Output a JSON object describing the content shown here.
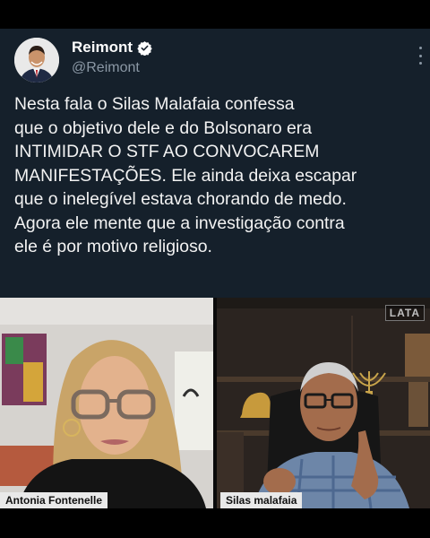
{
  "tweet": {
    "author_name": "Reimont",
    "handle": "@Reimont",
    "text": "Nesta fala o Silas Malafaia confessa\nque o objetivo dele e do Bolsonaro era\nINTIMIDAR O STF AO CONVOCAREM\nMANIFESTAÇÕES. Ele ainda deixa escapar\nque o inelegível estava chorando de medo.\nAgora ele mente que a investigação contra\nele é por motivo religioso."
  },
  "video": {
    "left_name": "Antonia Fontenelle",
    "right_name": "Silas malafaia",
    "watermark": "LATA"
  },
  "colors": {
    "background": "#15202b",
    "verified_badge": "#ffffff"
  },
  "icons": {
    "verified": "verified-badge-icon",
    "more": "more-options-icon"
  }
}
